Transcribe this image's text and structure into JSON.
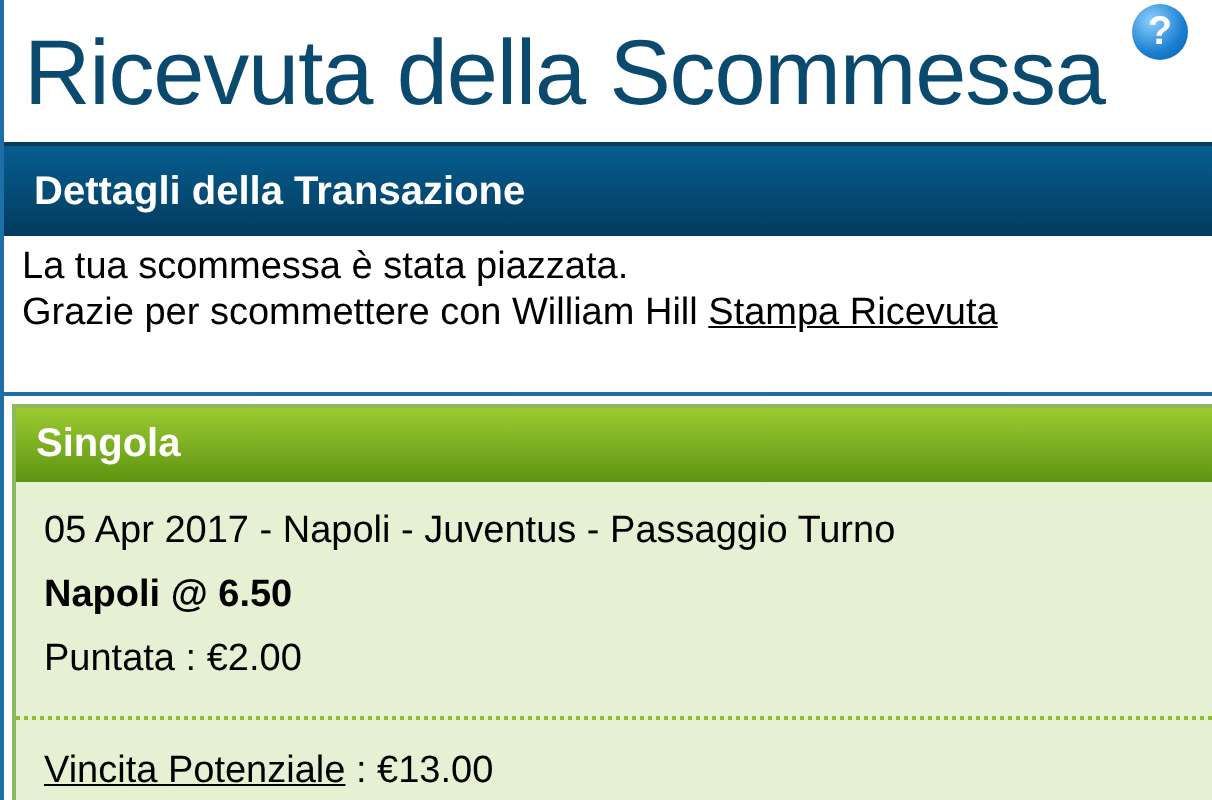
{
  "title": "Ricevuta della Scommessa",
  "help_icon": "?",
  "transaction": {
    "heading": "Dettagli della Transazione",
    "message": "La tua scommessa è stata piazzata.",
    "thanks": "Grazie per scommettere con William Hill",
    "print_link": "Stampa Ricevuta"
  },
  "bet": {
    "heading": "Singola",
    "event": "05 Apr 2017 - Napoli - Juventus - Passaggio Turno",
    "selection": "Napoli @ 6.50",
    "stake": "Puntata : €2.00",
    "potential_win_link": "Vincita Potenziale",
    "potential_win_value": " : €13.00"
  }
}
